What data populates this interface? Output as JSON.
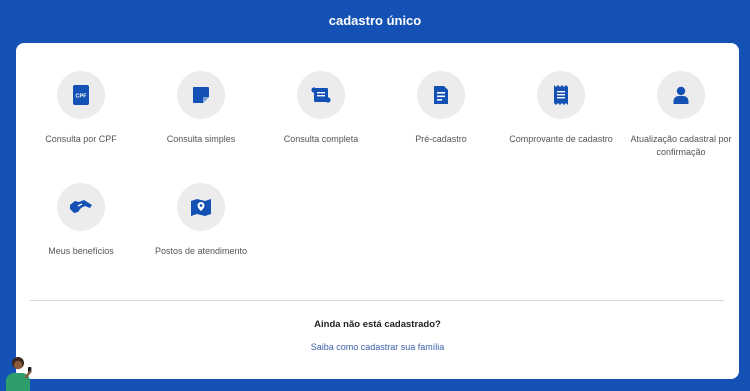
{
  "header": {
    "title": "cadastro único"
  },
  "services": [
    {
      "label": "Consulta por CPF",
      "icon": "cpf-card-icon"
    },
    {
      "label": "Consulta simples",
      "icon": "sticky-note-icon"
    },
    {
      "label": "Consulta completa",
      "icon": "scroll-icon"
    },
    {
      "label": "Pré-cadastro",
      "icon": "document-form-icon"
    },
    {
      "label": "Comprovante de cadastro",
      "icon": "receipt-icon"
    },
    {
      "label": "Atualização cadastral por confirmação",
      "icon": "user-icon"
    },
    {
      "label": "Meus benefícios",
      "icon": "handshake-icon"
    },
    {
      "label": "Postos de atendimento",
      "icon": "map-pin-icon"
    }
  ],
  "cpf_badge": "CPF",
  "cta": {
    "title": "Ainda não está cadastrado?",
    "link": "Saiba como cadastrar sua família"
  },
  "colors": {
    "brand_blue": "#1351b4",
    "icon_blue": "#1351b4",
    "circle_bg": "#ececec",
    "link": "#3b5fa8"
  }
}
